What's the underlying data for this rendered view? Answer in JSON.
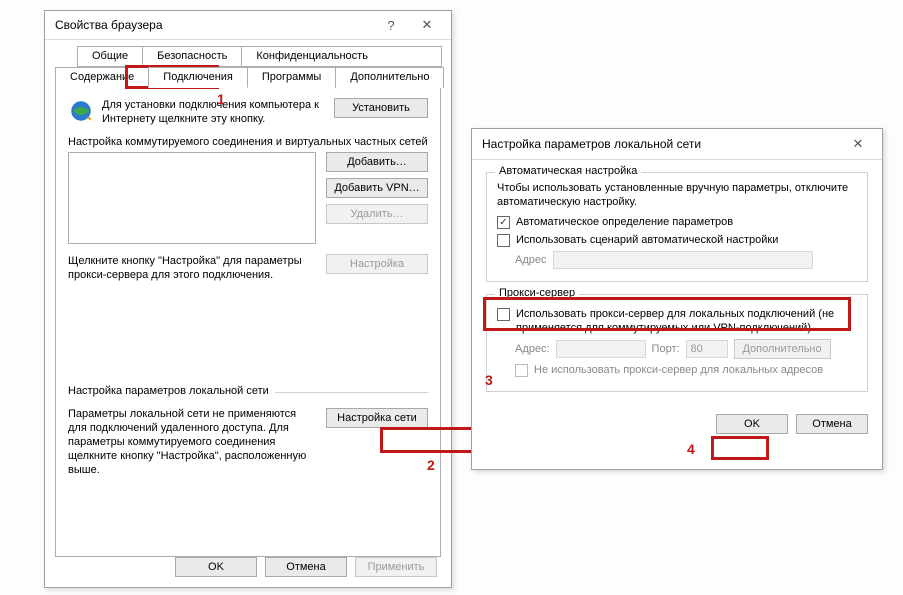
{
  "win1": {
    "title": "Свойства браузера",
    "help_icon": "?",
    "close_icon": "✕",
    "tabs_row1": {
      "general": "Общие",
      "security": "Безопасность",
      "privacy": "Конфиденциальность"
    },
    "tabs_row2": {
      "content": "Содержание",
      "connections": "Подключения",
      "programs": "Программы",
      "advanced": "Дополнительно"
    },
    "setup": {
      "text": "Для установки подключения компьютера к Интернету щелкните эту кнопку.",
      "btn": "Установить"
    },
    "dialup": {
      "title": "Настройка коммутируемого соединения и виртуальных частных сетей",
      "add_btn": "Добавить…",
      "add_vpn_btn": "Добавить VPN…",
      "remove_btn": "Удалить…",
      "settings_btn": "Настройка",
      "note": "Щелкните кнопку \"Настройка\" для параметры прокси-сервера для этого подключения."
    },
    "lan": {
      "title": "Настройка параметров локальной сети",
      "text": "Параметры локальной сети не применяются для подключений удаленного доступа. Для параметры коммутируемого соединения щелкните кнопку \"Настройка\", расположенную выше.",
      "btn": "Настройка сети"
    },
    "footer": {
      "ok": "OK",
      "cancel": "Отмена",
      "apply": "Применить"
    }
  },
  "win2": {
    "title": "Настройка параметров локальной сети",
    "close_icon": "✕",
    "auto": {
      "legend": "Автоматическая настройка",
      "desc": "Чтобы использовать установленные вручную параметры, отключите автоматическую настройку.",
      "auto_detect": "Автоматическое определение параметров",
      "use_script": "Использовать сценарий автоматической настройки",
      "address_lbl": "Адрес"
    },
    "proxy": {
      "legend": "Прокси-сервер",
      "use_proxy": "Использовать прокси-сервер для локальных подключений (не применяется для коммутируемых или VPN-подключений).",
      "addr_lbl": "Адрес:",
      "port_lbl": "Порт:",
      "port_value": "80",
      "adv_btn": "Дополнительно",
      "bypass_local": "Не использовать прокси-сервер для локальных адресов"
    },
    "footer": {
      "ok": "OK",
      "cancel": "Отмена"
    }
  },
  "annotations": {
    "n1": "1",
    "n2": "2",
    "n3": "3",
    "n4": "4"
  }
}
